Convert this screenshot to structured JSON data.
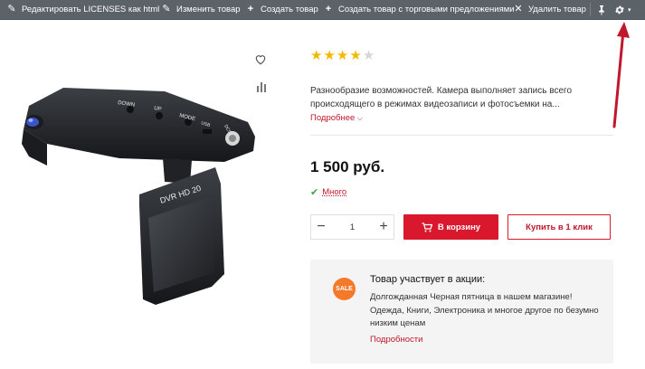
{
  "toolbar": {
    "edit_licenses": "Редактировать LICENSES как html",
    "edit_product": "Изменить товар",
    "create_product": "Создать товар",
    "create_with_offers": "Создать товар с торговыми предложениями",
    "delete_product": "Удалить товар"
  },
  "product": {
    "rating": 4,
    "rating_max": 5,
    "description": "Разнообразие возможностей. Камера выполняет запись всего происходящего в режимах видеозаписи и фотосъемки на...",
    "more_link": "Подробнее",
    "price": "1 500 руб.",
    "stock": "Много",
    "quantity": "1",
    "add_to_cart": "В корзину",
    "buy_one_click": "Купить в 1 клик",
    "image_labels": {
      "down": "DOWN",
      "up": "UP",
      "mode": "MODE",
      "usb": "USB",
      "dc5v": "DC5V",
      "model": "DVR HD 20"
    }
  },
  "promo": {
    "badge": "SALE",
    "title": "Товар участвует в акции:",
    "text": "Долгожданная Черная пятница в нашем магазине! Одежда, Книги, Электроника и многое другое по безумно низким ценам",
    "link": "Подробности"
  },
  "colors": {
    "accent": "#d9172d",
    "toolbar_bg": "#5b6268",
    "star_filled": "#f5b800",
    "star_empty": "#d6d6d6",
    "sale_badge": "#f4792a",
    "arrow": "#c0172c"
  },
  "icons": {
    "edit": "pencil-icon",
    "create": "plus-icon",
    "delete": "close-icon",
    "pin": "pin-icon",
    "settings": "gear-icon",
    "favorite": "heart-icon",
    "compare": "compare-bars-icon"
  }
}
